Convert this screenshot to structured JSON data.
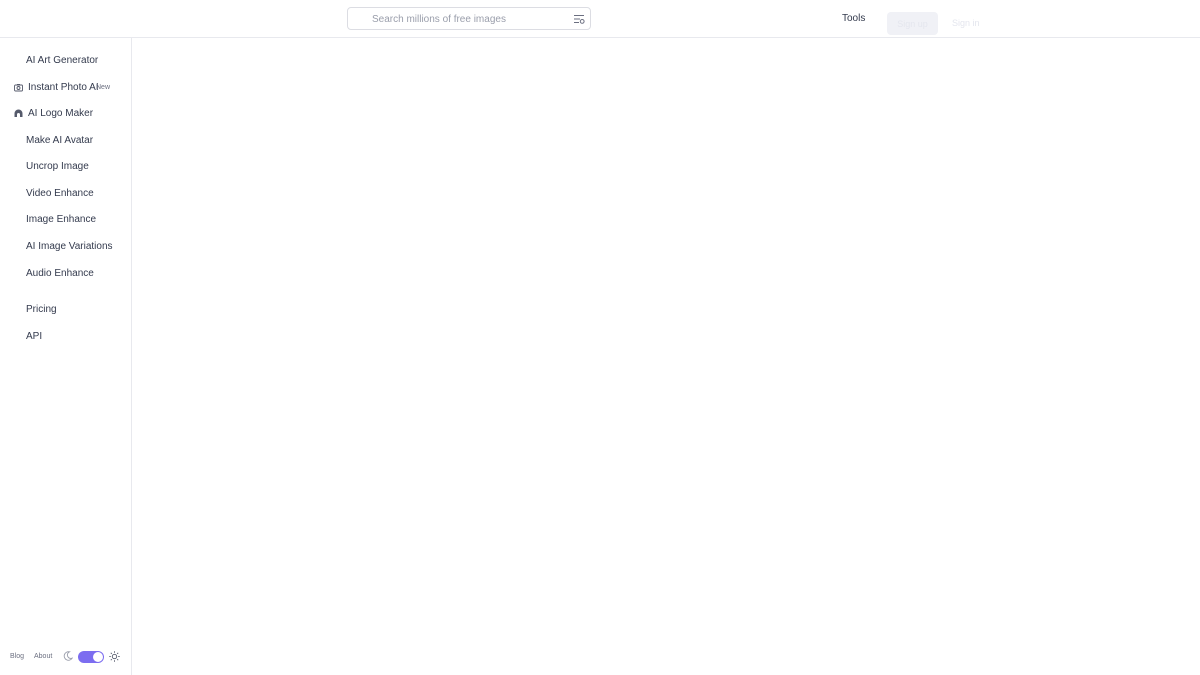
{
  "header": {
    "search": {
      "placeholder": "Search millions of free images",
      "value": ""
    },
    "tools_label": "Tools",
    "signup_label": "Sign up",
    "signin_label": "Sign in"
  },
  "sidebar": {
    "items": [
      {
        "label": "AI Art Generator"
      },
      {
        "label": "Instant Photo AI",
        "badge": "New",
        "icon": "camera-icon"
      },
      {
        "label": "AI Logo Maker",
        "icon": "logo-icon"
      },
      {
        "label": "Make AI Avatar"
      },
      {
        "label": "Uncrop Image"
      },
      {
        "label": "Video Enhance"
      },
      {
        "label": "Image Enhance"
      },
      {
        "label": "AI Image Variations"
      },
      {
        "label": "Audio Enhance"
      }
    ],
    "secondary": [
      {
        "label": "Pricing"
      },
      {
        "label": "API"
      }
    ],
    "footer": {
      "blog_label": "Blog",
      "about_label": "About"
    }
  },
  "colors": {
    "accent": "#7c6df0",
    "text": "#333a4d",
    "muted": "#9a9eab",
    "border": "#e8e9ee"
  }
}
